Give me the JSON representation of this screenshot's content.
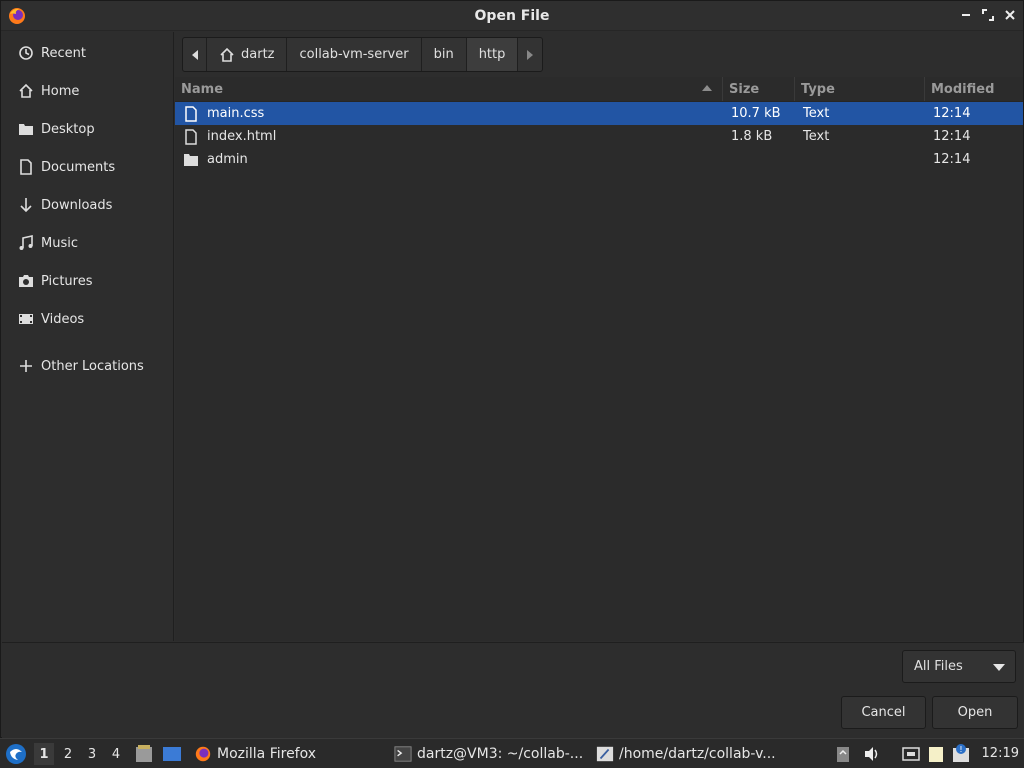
{
  "window": {
    "title": "Open File",
    "controls": [
      "minimize",
      "maximize",
      "close"
    ]
  },
  "sidebar": {
    "items": [
      {
        "label": "Recent",
        "icon": "clock-icon"
      },
      {
        "label": "Home",
        "icon": "home-icon"
      },
      {
        "label": "Desktop",
        "icon": "folder-icon"
      },
      {
        "label": "Documents",
        "icon": "document-icon"
      },
      {
        "label": "Downloads",
        "icon": "download-icon"
      },
      {
        "label": "Music",
        "icon": "music-icon"
      },
      {
        "label": "Pictures",
        "icon": "camera-icon"
      },
      {
        "label": "Videos",
        "icon": "video-icon"
      }
    ],
    "other": {
      "label": "Other Locations",
      "icon": "plus-icon"
    }
  },
  "pathbar": {
    "crumbs": [
      "dartz",
      "collab-vm-server",
      "bin",
      "http"
    ],
    "active": "http"
  },
  "filelist": {
    "columns": {
      "name": "Name",
      "size": "Size",
      "type": "Type",
      "modified": "Modified"
    },
    "sort": {
      "column": "Name",
      "direction": "ascending"
    },
    "rows": [
      {
        "name": "main.css",
        "size": "10.7 kB",
        "type": "Text",
        "modified": "12:14",
        "kind": "file",
        "selected": true
      },
      {
        "name": "index.html",
        "size": "1.8 kB",
        "type": "Text",
        "modified": "12:14",
        "kind": "file",
        "selected": false
      },
      {
        "name": "admin",
        "size": "",
        "type": "",
        "modified": "12:14",
        "kind": "folder",
        "selected": false
      }
    ]
  },
  "footer": {
    "filter": "All Files",
    "cancel": "Cancel",
    "open": "Open"
  },
  "taskbar": {
    "workspaces": [
      "1",
      "2",
      "3",
      "4"
    ],
    "active_workspace": "1",
    "tasks": [
      {
        "label": "Mozilla Firefox",
        "icon": "firefox-icon"
      },
      {
        "label": "dartz@VM3: ~/collab-...",
        "icon": "terminal-icon"
      },
      {
        "label": "/home/dartz/collab-v...",
        "icon": "editor-icon"
      }
    ],
    "clock": "12:19"
  },
  "colors": {
    "selection": "#2255a4",
    "background": "#2d2d2d",
    "text": "#e6e6e6"
  }
}
